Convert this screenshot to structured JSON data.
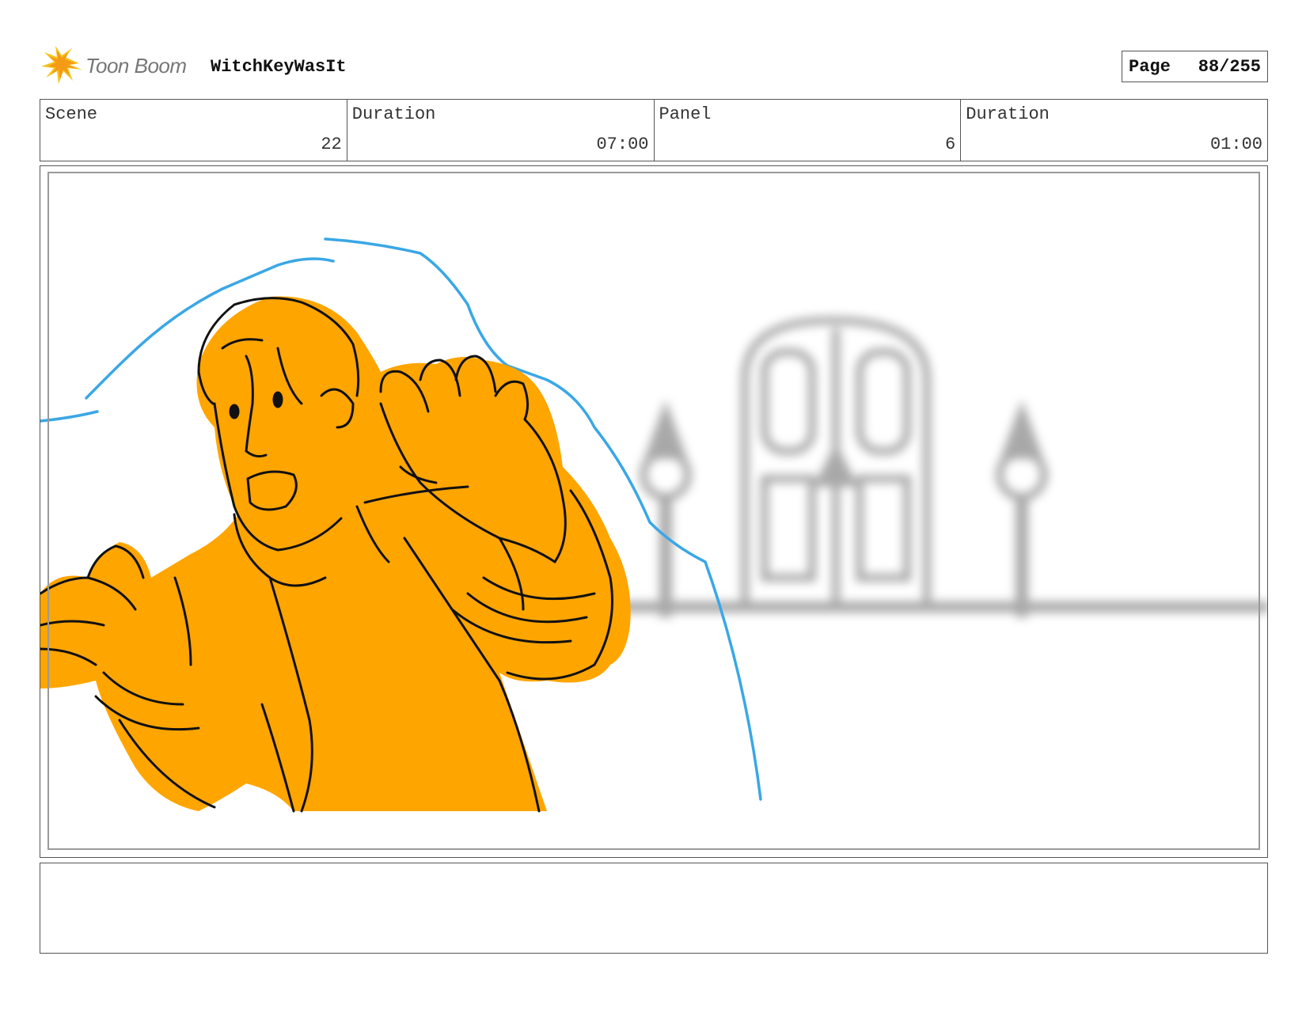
{
  "header": {
    "logo_text": "Toon Boom",
    "project_title": "WitchKeyWasIt",
    "page_label": "Page",
    "page_value": "88/255"
  },
  "info": {
    "scene_label": "Scene",
    "scene_value": "22",
    "scene_duration_label": "Duration",
    "scene_duration_value": "07:00",
    "panel_label": "Panel",
    "panel_value": "6",
    "panel_duration_label": "Duration",
    "panel_duration_value": "01:00"
  },
  "notes": {
    "text": ""
  },
  "colors": {
    "character_fill": "#ffa500",
    "motion_line": "#3aa7e6",
    "background_blur": "#9a9a9a"
  }
}
